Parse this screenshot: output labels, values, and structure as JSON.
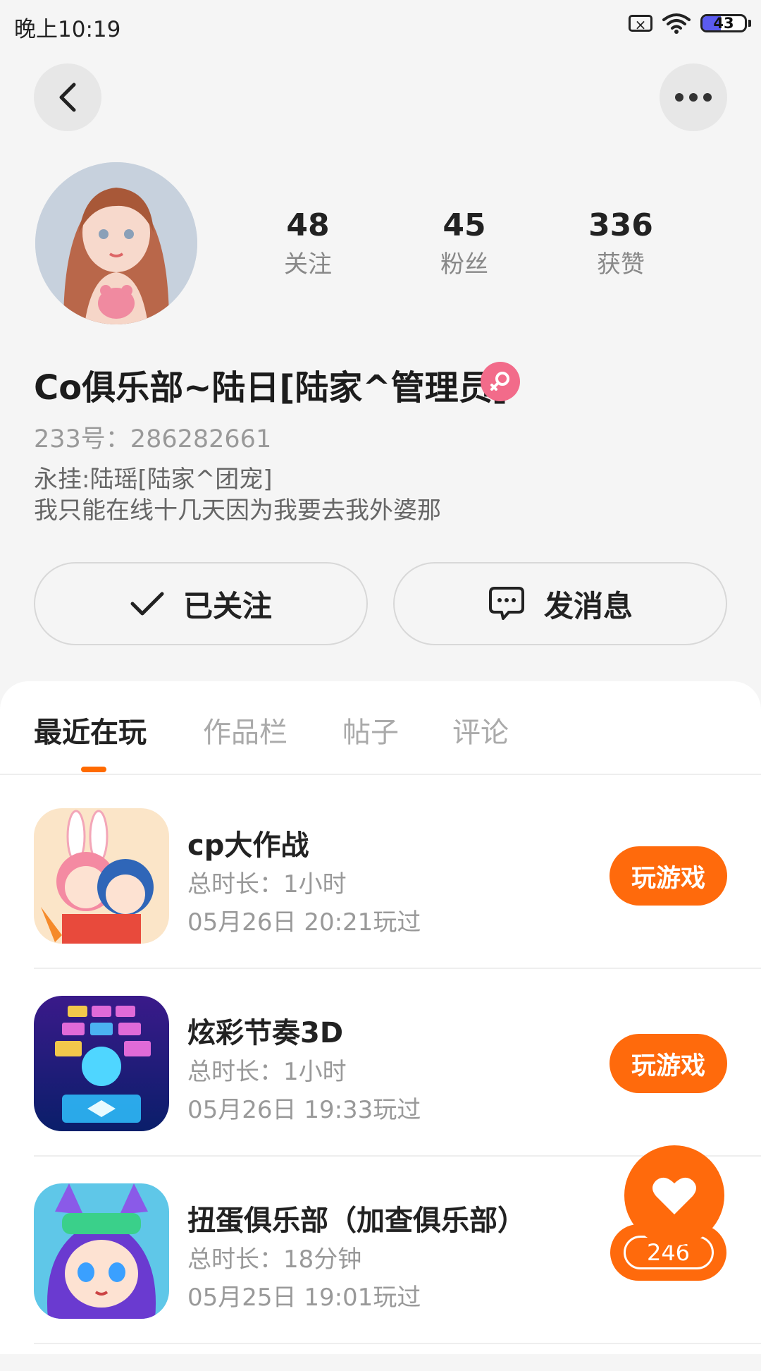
{
  "status_bar": {
    "time": "晚上10:19",
    "battery": 43
  },
  "profile": {
    "name": "Co俱乐部~陆日[陆家^管理员]",
    "id_text": "233号：286282661",
    "bio": [
      "永挂:陆瑶[陆家^团宠]",
      "我只能在线十几天因为我要去我外婆那"
    ],
    "stats": [
      {
        "value": "48",
        "label": "关注"
      },
      {
        "value": "45",
        "label": "粉丝"
      },
      {
        "value": "336",
        "label": "获赞"
      }
    ]
  },
  "actions": {
    "follow_label": "已关注",
    "message_label": "发消息"
  },
  "tabs": [
    {
      "label": "最近在玩",
      "active": true
    },
    {
      "label": "作品栏",
      "active": false
    },
    {
      "label": "帖子",
      "active": false
    },
    {
      "label": "评论",
      "active": false
    }
  ],
  "games": [
    {
      "title": "cp大作战",
      "duration": "总时长：1小时",
      "last_played": "05月26日 20:21玩过",
      "button": "玩游戏",
      "icon": "cp-game-icon"
    },
    {
      "title": "炫彩节奏3D",
      "duration": "总时长：1小时",
      "last_played": "05月26日 19:33玩过",
      "button": "玩游戏",
      "icon": "rhythm-game-icon"
    },
    {
      "title": "扭蛋俱乐部（加查俱乐部）",
      "duration": "总时长：18分钟",
      "last_played": "05月25日 19:01玩过",
      "button": "",
      "icon": "gacha-game-icon"
    }
  ],
  "like": {
    "count": "246"
  },
  "colors": {
    "accent": "#ff6a0c",
    "female_badge": "#f26b8a",
    "background": "#f5f5f5"
  }
}
